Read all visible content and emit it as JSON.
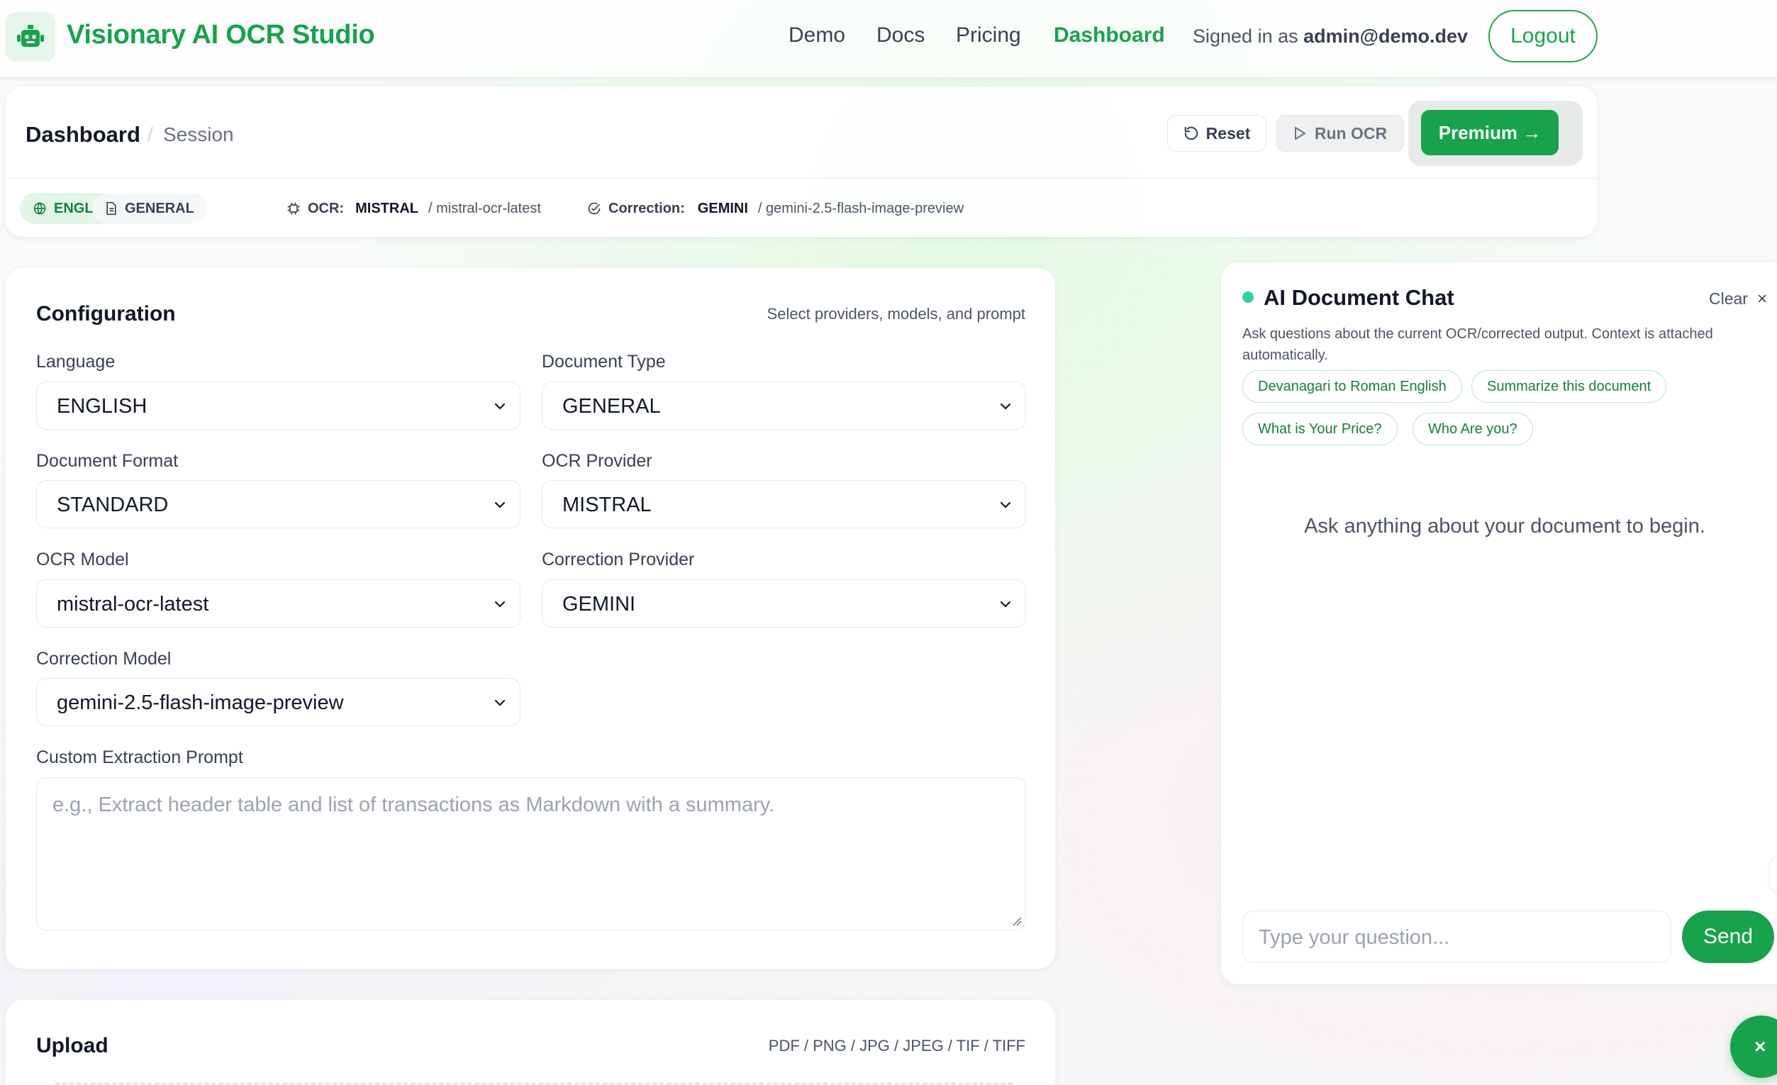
{
  "nav": {
    "brand": "Visionary AI OCR Studio",
    "brand_icon": "robot-icon",
    "links": [
      "Demo",
      "Docs",
      "Pricing",
      "Dashboard"
    ],
    "active": "Dashboard",
    "signed_in_prefix": "Signed in as",
    "signed_in_user": "admin@demo.dev",
    "logout": "Logout"
  },
  "session": {
    "title": "Dashboard",
    "separator": "/",
    "subtitle": "Session",
    "reset": "Reset",
    "run_ocr": "Run OCR",
    "premium": "Premium →",
    "chips": {
      "language": "ENGLISH",
      "doc_type": "GENERAL",
      "ocr_label": "OCR:",
      "ocr_provider": "MISTRAL",
      "ocr_model": "/ mistral-ocr-latest",
      "correction_label": "Correction:",
      "correction_provider": "GEMINI",
      "correction_model": "/ gemini-2.5-flash-image-preview"
    }
  },
  "config": {
    "title": "Configuration",
    "hint": "Select providers, models, and prompt",
    "fields": {
      "language": {
        "label": "Language",
        "value": "ENGLISH"
      },
      "document_type": {
        "label": "Document Type",
        "value": "GENERAL"
      },
      "document_format": {
        "label": "Document Format",
        "value": "STANDARD"
      },
      "ocr_provider": {
        "label": "OCR Provider",
        "value": "MISTRAL"
      },
      "ocr_model": {
        "label": "OCR Model",
        "value": "mistral-ocr-latest"
      },
      "correction_provider": {
        "label": "Correction Provider",
        "value": "GEMINI"
      },
      "correction_model": {
        "label": "Correction Model",
        "value": "gemini-2.5-flash-image-preview"
      }
    },
    "prompt": {
      "label": "Custom Extraction Prompt",
      "placeholder": "e.g., Extract header table and list of transactions as Markdown with a summary."
    }
  },
  "upload": {
    "title": "Upload",
    "formats": "PDF / PNG / JPG / JPEG / TIF / TIFF"
  },
  "chat": {
    "title": "AI Document Chat",
    "clear": "Clear",
    "close": "×",
    "description": "Ask questions about the current OCR/corrected output. Context is attached automatically.",
    "suggestions": [
      "Devanagari to Roman English",
      "Summarize this document",
      "What is Your Price?",
      "Who Are you?"
    ],
    "empty_state": "Ask anything about your document to begin.",
    "input_placeholder": "Type your question...",
    "send": "Send"
  },
  "fab": {
    "label": "×"
  },
  "colors": {
    "accent": "#16a34a",
    "accent_light": "#e3f5e7",
    "status_dot": "#34d399"
  }
}
